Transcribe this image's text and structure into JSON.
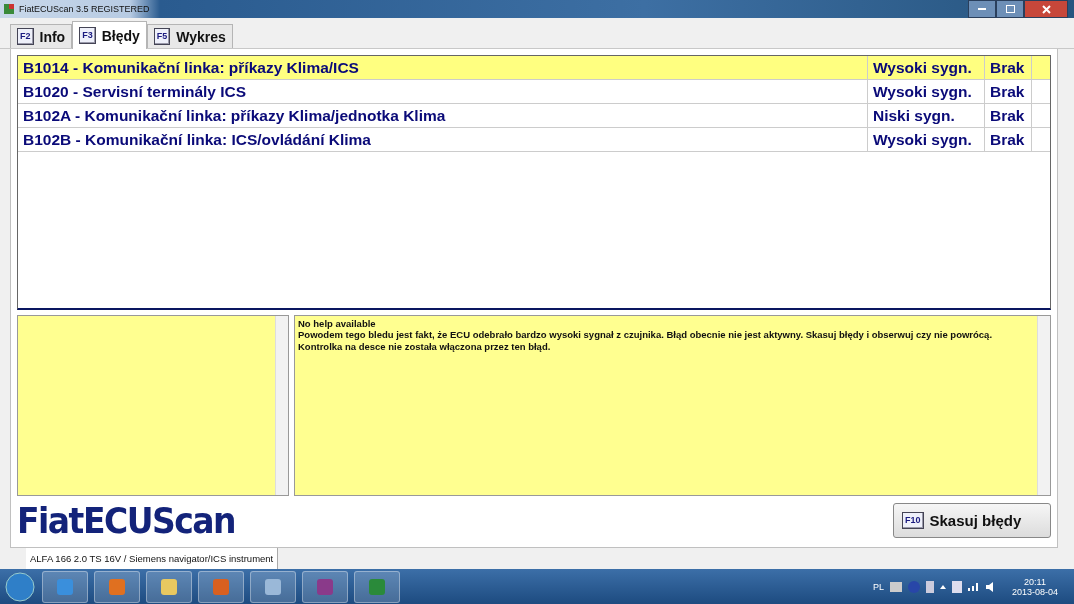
{
  "window": {
    "title": "FiatECUScan 3.5 REGISTERED"
  },
  "tabs": [
    {
      "key": "F2",
      "label": "Info",
      "selected": false
    },
    {
      "key": "F3",
      "label": "Błędy",
      "selected": true
    },
    {
      "key": "F5",
      "label": "Wykres",
      "selected": false
    }
  ],
  "faults": [
    {
      "description": "B1014 - Komunikační linka: příkazy Klima/ICS",
      "signal": "Wysoki sygn.",
      "status": "Brak",
      "selected": true
    },
    {
      "description": "B1020 - Servisní terminály ICS",
      "signal": "Wysoki sygn.",
      "status": "Brak",
      "selected": false
    },
    {
      "description": "B102A - Komunikační linka: příkazy Klima/jednotka Klima",
      "signal": "Niski sygn.",
      "status": "Brak",
      "selected": false
    },
    {
      "description": "B102B - Komunikační linka: ICS/ovládání Klima",
      "signal": "Wysoki sygn.",
      "status": "Brak",
      "selected": false
    }
  ],
  "help": {
    "title": "No help available",
    "text": "Powodem tego bledu jest fakt, że ECU odebrało bardzo wysoki sygnał z czujnika. Błąd obecnie nie jest aktywny. Skasuj błędy i obserwuj czy nie powrócą. Kontrolka na desce nie została włączona przez ten błąd."
  },
  "logo": "FiatECUScan",
  "clear_button": {
    "key": "F10",
    "label": "Skasuj błędy"
  },
  "status_bar": "ALFA 166 2.0 TS 16V / Siemens navigator/ICS instrument",
  "taskbar": {
    "language": "PL",
    "time": "20:11",
    "date": "2013-08-04"
  }
}
